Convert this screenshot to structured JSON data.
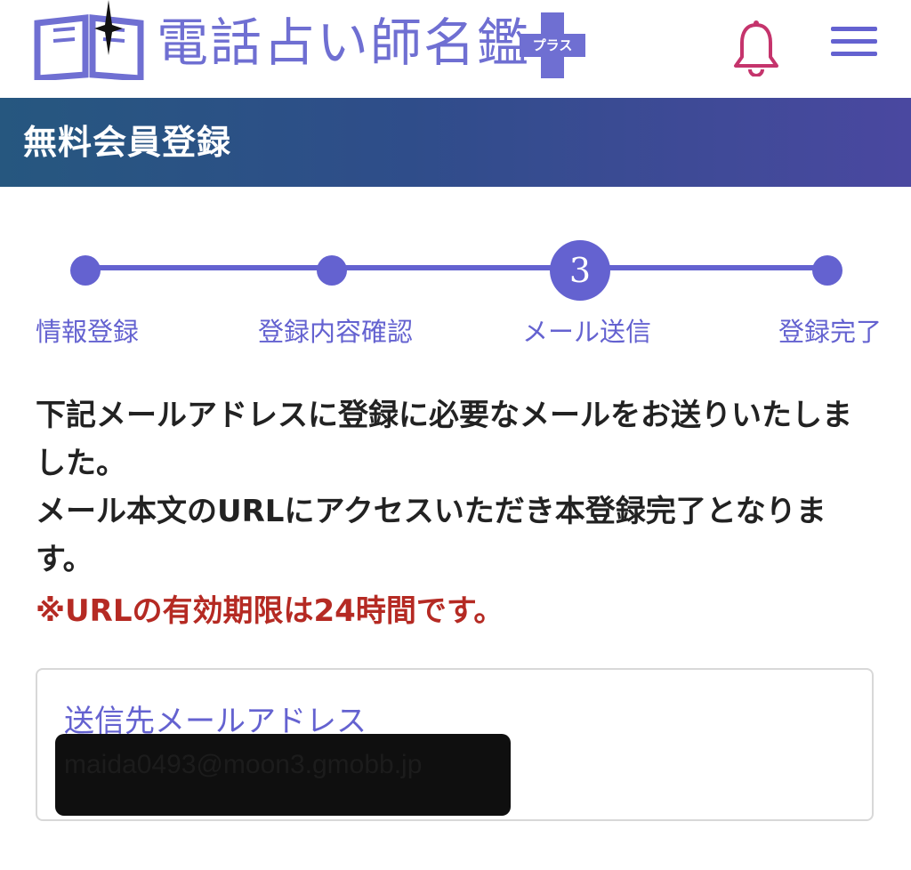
{
  "header": {
    "site_name": "電話占い師名鑑",
    "plus_badge": "プラス",
    "icons": {
      "logo": "open-book-star-icon",
      "notification": "bell-icon",
      "menu": "hamburger-menu-icon"
    },
    "colors": {
      "brand": "#6462d0",
      "bell": "#c5346c"
    }
  },
  "title_band": {
    "title": "無料会員登録"
  },
  "stepper": {
    "current_step": 3,
    "current_number": "3",
    "steps": [
      {
        "label": "情報登録"
      },
      {
        "label": "登録内容確認"
      },
      {
        "label": "メール送信"
      },
      {
        "label": "登録完了"
      }
    ]
  },
  "message": {
    "line1": "下記メールアドレスに登録に必要なメールをお送りいたしました。",
    "line2": "メール本文のURLにアクセスいただき本登録完了となります。",
    "warning": "※URLの有効期限は24時間です。"
  },
  "email": {
    "label": "送信先メールアドレス",
    "value": "maida0493@moon3.gmobb.jp"
  }
}
